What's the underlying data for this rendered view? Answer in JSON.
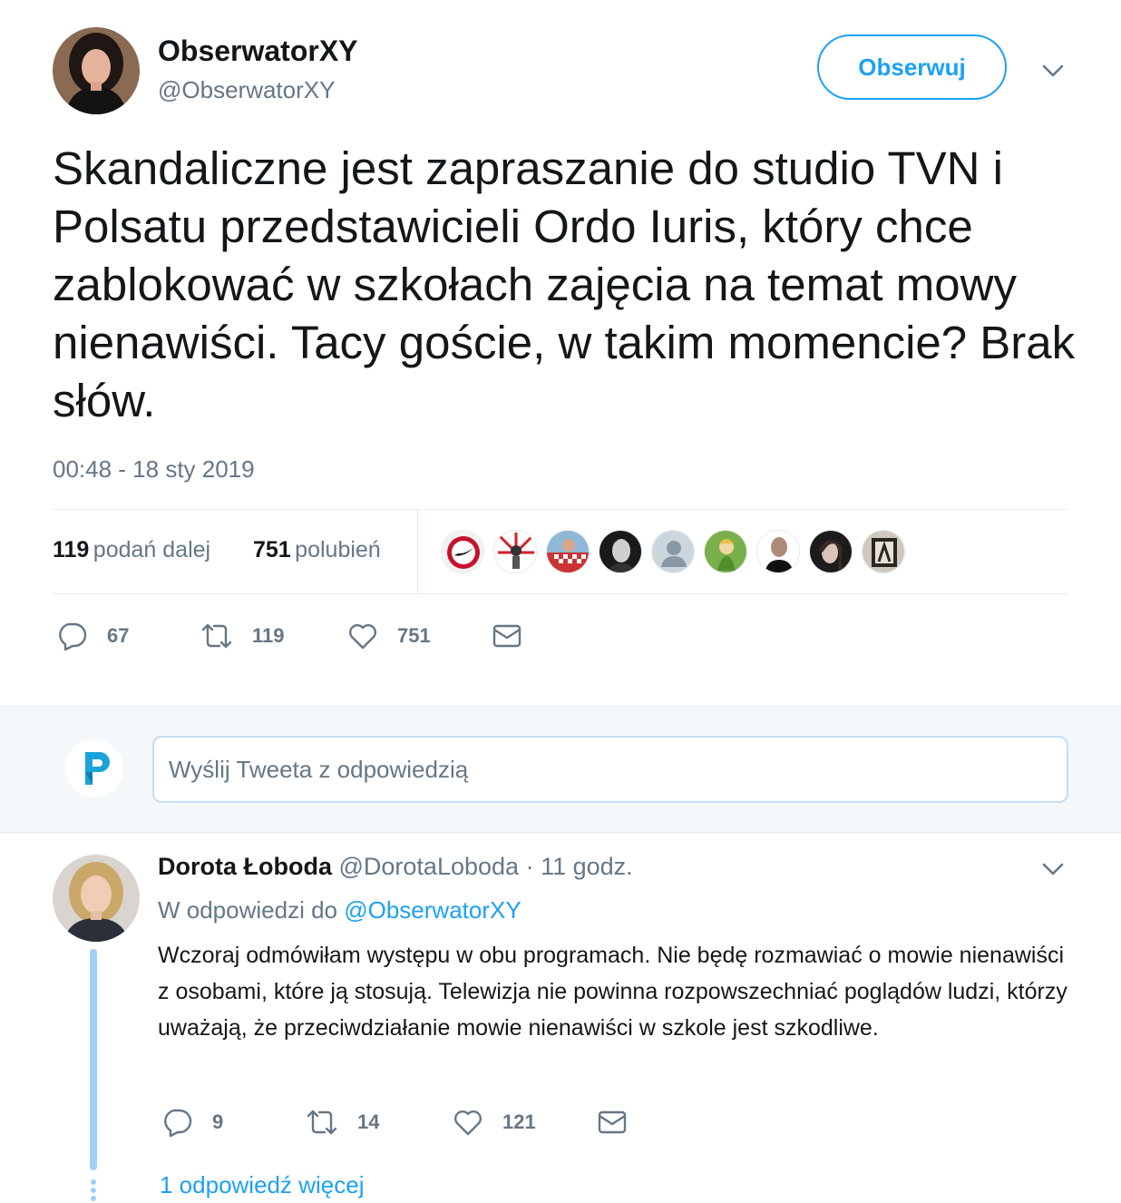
{
  "tweet": {
    "author_name": "ObserwatorXY",
    "author_handle": "@ObserwatorXY",
    "follow_label": "Obserwuj",
    "text": "Skandaliczne jest zapraszanie do studio TVN i Polsatu przedstawicieli Ordo Iuris, który chce zablokować w szkołach zajęcia na temat mowy nienawiści. Tacy goście, w takim momencie? Brak słów.",
    "timestamp": "00:48 - 18 sty 2019",
    "retweets_count": "119",
    "retweets_label": "podań dalej",
    "likes_count": "751",
    "likes_label": "polubień",
    "actions": {
      "replies": "67",
      "retweets": "119",
      "likes": "751"
    }
  },
  "reply_box": {
    "placeholder": "Wyślij Tweeta z odpowiedzią"
  },
  "reply": {
    "author_name": "Dorota Łoboda",
    "author_handle": "@DorotaLoboda",
    "separator": "·",
    "time": "11 godz.",
    "in_reply_prefix": "W odpowiedzi do",
    "in_reply_handle": "@ObserwatorXY",
    "text": "Wczoraj odmówiłam występu w obu programach. Nie będę rozmawiać o mowie nienawiści z osobami, które ją stosują. Telewizja nie powinna rozpowszechniać poglądów ludzi, którzy uważają, że przeciwdziałanie mowie nienawiści w szkole jest szkodliwe.",
    "actions": {
      "replies": "9",
      "retweets": "14",
      "likes": "121"
    },
    "more_replies": "1 odpowiedź więcej"
  },
  "colors": {
    "accent": "#1da1f2",
    "muted": "#657786",
    "text": "#14171a",
    "divider": "#e6ecf0",
    "thread": "#9ed0f6"
  },
  "icons": [
    "chevron-down-icon",
    "reply-icon",
    "retweet-icon",
    "like-icon",
    "message-icon",
    "logo-icon"
  ]
}
